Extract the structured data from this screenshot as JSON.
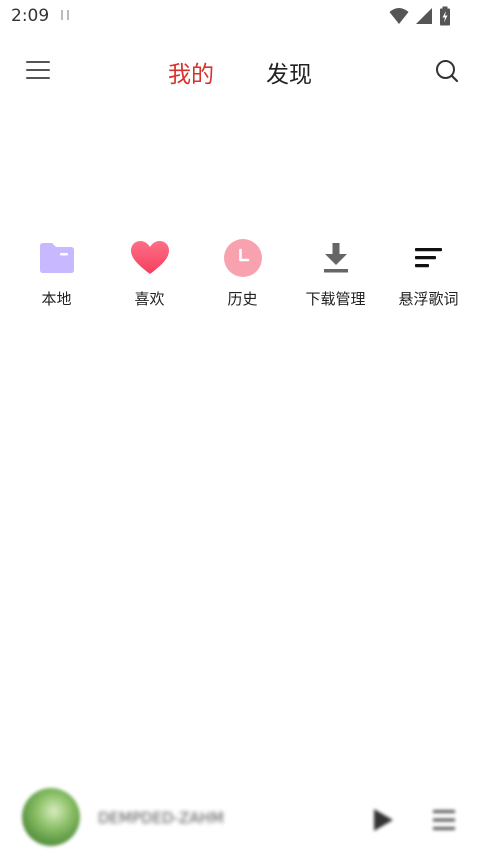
{
  "status_bar": {
    "time": "2:09",
    "icons": [
      "wifi-icon",
      "cell-signal-icon",
      "battery-icon"
    ]
  },
  "top_nav": {
    "menu_icon": "hamburger-menu-icon",
    "tabs": [
      {
        "label": "我的",
        "active": true
      },
      {
        "label": "发现",
        "active": false
      }
    ],
    "search_icon": "search-icon",
    "active_color": "#d8322f"
  },
  "quick_entries": [
    {
      "label": "本地",
      "icon": "folder-icon",
      "color": "#c7b8ff"
    },
    {
      "label": "喜欢",
      "icon": "heart-icon",
      "color": "#fb5672"
    },
    {
      "label": "历史",
      "icon": "clock-icon",
      "color": "#f9a2af"
    },
    {
      "label": "下载管理",
      "icon": "download-icon",
      "color": "#666666"
    },
    {
      "label": "悬浮歌词",
      "icon": "lyrics-icon",
      "color": "#111111"
    }
  ],
  "mini_player": {
    "song": "DEMPDED-ZAHM",
    "album_art_icon": "album-art",
    "play_icon": "play-icon",
    "playlist_icon": "playlist-icon"
  }
}
